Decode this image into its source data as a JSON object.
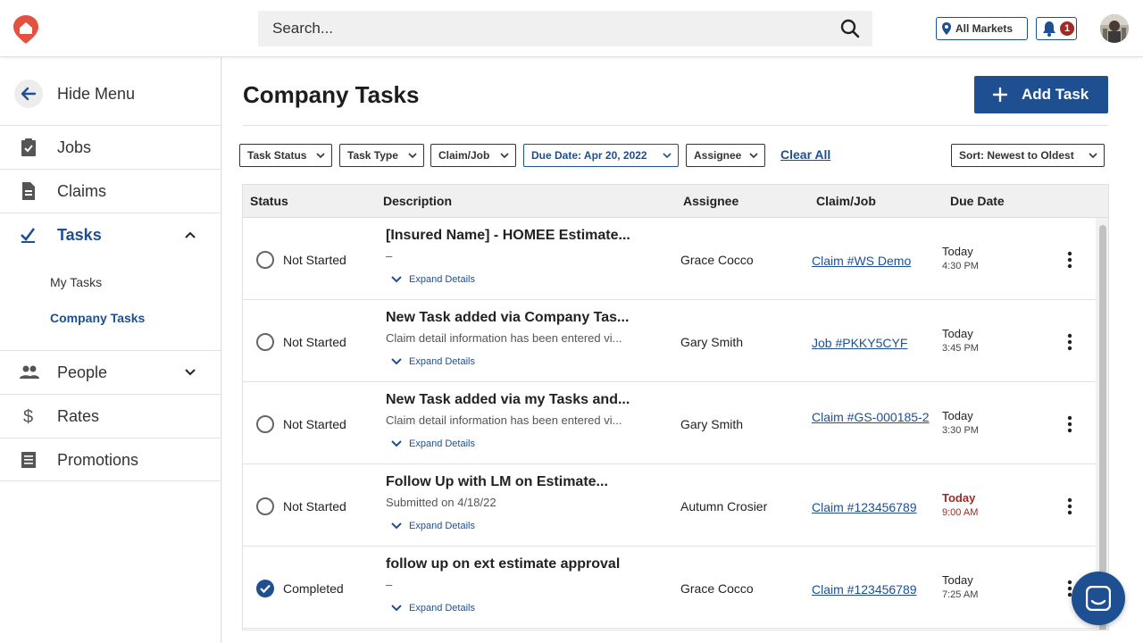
{
  "topbar": {
    "search_placeholder": "Search...",
    "markets_label": "All Markets",
    "notification_count": "1"
  },
  "sidebar": {
    "hide_menu": "Hide Menu",
    "items": [
      {
        "label": "Jobs",
        "icon": "clipboard-check-icon"
      },
      {
        "label": "Claims",
        "icon": "document-icon"
      },
      {
        "label": "Tasks",
        "icon": "checkmark-icon"
      },
      {
        "label": "People",
        "icon": "people-icon"
      },
      {
        "label": "Rates",
        "icon": "dollar-icon"
      },
      {
        "label": "Promotions",
        "icon": "receipt-icon"
      }
    ],
    "sub_items": [
      "My Tasks",
      "Company Tasks"
    ]
  },
  "page": {
    "title": "Company Tasks",
    "add_task": "Add Task"
  },
  "filters": {
    "task_status": "Task Status",
    "task_type": "Task Type",
    "claim_job": "Claim/Job",
    "due_date": "Due Date: Apr 20, 2022",
    "assignee": "Assignee",
    "clear_all": "Clear All",
    "sort": "Sort: Newest to Oldest"
  },
  "table": {
    "headers": [
      "Status",
      "Description",
      "Assignee",
      "Claim/Job",
      "Due Date"
    ],
    "expand_label": "Expand Details",
    "rows": [
      {
        "status": "Not Started",
        "title": "[Insured Name] - HOMEE Estimate...",
        "subtitle": "–",
        "assignee": "Grace Cocco",
        "claim": "Claim #WS Demo",
        "due_day": "Today",
        "due_time": "4:30 PM"
      },
      {
        "status": "Not Started",
        "title": "New Task added via Company Tas...",
        "subtitle": "Claim detail information has been entered vi...",
        "assignee": "Gary Smith",
        "claim": "Job #PKKY5CYF",
        "due_day": "Today",
        "due_time": "3:45 PM"
      },
      {
        "status": "Not Started",
        "title": "New Task added via my Tasks and...",
        "subtitle": "Claim detail information has been entered vi...",
        "assignee": "Gary Smith",
        "claim": "Claim #GS-000185-2",
        "due_day": "Today",
        "due_time": "3:30 PM"
      },
      {
        "status": "Not Started",
        "title": "Follow Up with LM on Estimate...",
        "subtitle": "Submitted on 4/18/22",
        "assignee": "Autumn Crosier",
        "claim": "Claim #123456789",
        "due_day": "Today",
        "due_time": "9:00 AM"
      },
      {
        "status": "Completed",
        "title": "follow up on ext estimate approval",
        "subtitle": "–",
        "assignee": "Grace Cocco",
        "claim": "Claim #123456789",
        "due_day": "Today",
        "due_time": "7:25 AM"
      }
    ]
  },
  "colors": {
    "brand_blue": "#1d4f91",
    "overdue_red": "#a02a24",
    "logo_red": "#e4513f"
  }
}
